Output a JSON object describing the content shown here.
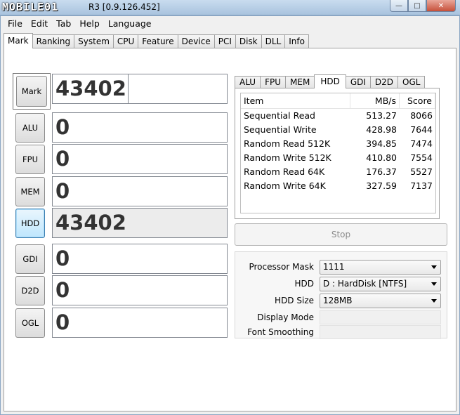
{
  "titlebar": {
    "logo_text": "MOBILE01",
    "title": "R3 [0.9.126.452]",
    "buttons": {
      "minimize": "—",
      "maximize": "□",
      "close": "✕"
    }
  },
  "menu": [
    "File",
    "Edit",
    "Tab",
    "Help",
    "Language"
  ],
  "tabs": [
    "Mark",
    "Ranking",
    "System",
    "CPU",
    "Feature",
    "Device",
    "PCI",
    "Disk",
    "DLL",
    "Info"
  ],
  "active_tab": "Mark",
  "scores": [
    {
      "label": "Mark",
      "value": "43402"
    },
    {
      "label": "ALU",
      "value": "0"
    },
    {
      "label": "FPU",
      "value": "0"
    },
    {
      "label": "MEM",
      "value": "0"
    },
    {
      "label": "HDD",
      "value": "43402"
    },
    {
      "label": "GDI",
      "value": "0"
    },
    {
      "label": "D2D",
      "value": "0"
    },
    {
      "label": "OGL",
      "value": "0"
    }
  ],
  "subtabs": [
    "ALU",
    "FPU",
    "MEM",
    "HDD",
    "GDI",
    "D2D",
    "OGL"
  ],
  "active_subtab": "HDD",
  "results": {
    "columns": [
      "Item",
      "MB/s",
      "Score"
    ],
    "rows": [
      [
        "Sequential Read",
        "513.27",
        "8066"
      ],
      [
        "Sequential Write",
        "428.98",
        "7644"
      ],
      [
        "Random Read 512K",
        "394.85",
        "7474"
      ],
      [
        "Random Write 512K",
        "410.80",
        "7554"
      ],
      [
        "Random Read 64K",
        "176.37",
        "5527"
      ],
      [
        "Random Write 64K",
        "327.59",
        "7137"
      ]
    ]
  },
  "stop_label": "Stop",
  "options": {
    "processor_mask": {
      "label": "Processor Mask",
      "value": "1111"
    },
    "hdd": {
      "label": "HDD",
      "value": "D : HardDisk [NTFS]"
    },
    "hdd_size": {
      "label": "HDD Size",
      "value": "128MB"
    },
    "display_mode": {
      "label": "Display Mode",
      "value": ""
    },
    "font_smoothing": {
      "label": "Font Smoothing",
      "value": ""
    }
  }
}
